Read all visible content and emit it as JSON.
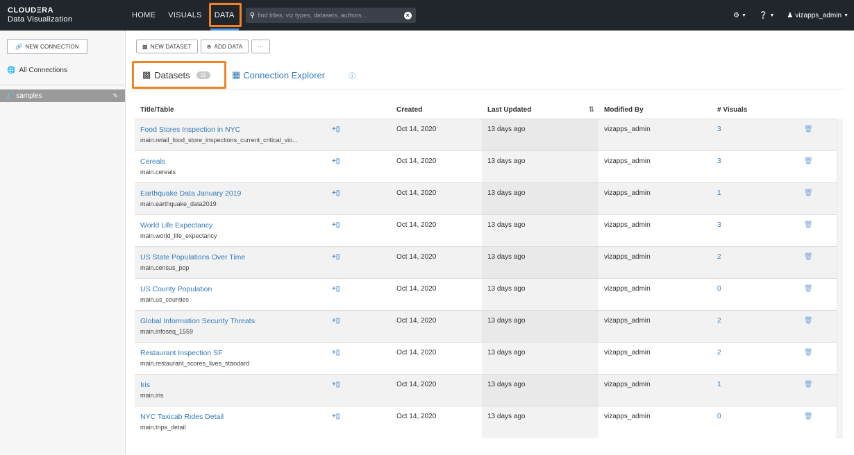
{
  "brand": {
    "line1": "CLOUDΞRA",
    "line2": "Data Visualization"
  },
  "nav": {
    "home": "HOME",
    "visuals": "VISUALS",
    "data": "DATA"
  },
  "search": {
    "placeholder": "find titles, viz types, datasets, authors..."
  },
  "topright": {
    "user": "vizapps_admin"
  },
  "sidebar": {
    "new_connection": "NEW CONNECTION",
    "all_connections": "All Connections",
    "connection": "samples"
  },
  "toolbar": {
    "new_dataset": "NEW DATASET",
    "add_data": "ADD DATA",
    "more": "···"
  },
  "tabs": {
    "datasets": "Datasets",
    "datasets_count": "11",
    "explorer": "Connection Explorer"
  },
  "columns": {
    "title": "Title/Table",
    "created": "Created",
    "last_updated": "Last Updated",
    "modified_by": "Modified By",
    "visuals": "# Visuals"
  },
  "rows": [
    {
      "title": "Food Stores Inspection in NYC",
      "table": "main.retail_food_store_inspections_current_critical_vio...",
      "created": "Oct 14, 2020",
      "updated": "13 days ago",
      "by": "vizapps_admin",
      "visuals": "3"
    },
    {
      "title": "Cereals",
      "table": "main.cereals",
      "created": "Oct 14, 2020",
      "updated": "13 days ago",
      "by": "vizapps_admin",
      "visuals": "3"
    },
    {
      "title": "Earthquake Data January 2019",
      "table": "main.earthquake_data2019",
      "created": "Oct 14, 2020",
      "updated": "13 days ago",
      "by": "vizapps_admin",
      "visuals": "1"
    },
    {
      "title": "World Life Expectancy",
      "table": "main.world_life_expectancy",
      "created": "Oct 14, 2020",
      "updated": "13 days ago",
      "by": "vizapps_admin",
      "visuals": "3"
    },
    {
      "title": "US State Populations Over Time",
      "table": "main.census_pop",
      "created": "Oct 14, 2020",
      "updated": "13 days ago",
      "by": "vizapps_admin",
      "visuals": "2"
    },
    {
      "title": "US County Population",
      "table": "main.us_counties",
      "created": "Oct 14, 2020",
      "updated": "13 days ago",
      "by": "vizapps_admin",
      "visuals": "0"
    },
    {
      "title": "Global Information Security Threats",
      "table": "main.infoseq_1559",
      "created": "Oct 14, 2020",
      "updated": "13 days ago",
      "by": "vizapps_admin",
      "visuals": "2"
    },
    {
      "title": "Restaurant Inspection SF",
      "table": "main.restaurant_scores_lives_standard",
      "created": "Oct 14, 2020",
      "updated": "13 days ago",
      "by": "vizapps_admin",
      "visuals": "2"
    },
    {
      "title": "Iris",
      "table": "main.iris",
      "created": "Oct 14, 2020",
      "updated": "13 days ago",
      "by": "vizapps_admin",
      "visuals": "1"
    },
    {
      "title": "NYC Taxicab Rides Detail",
      "table": "main.trips_detail",
      "created": "Oct 14, 2020",
      "updated": "13 days ago",
      "by": "vizapps_admin",
      "visuals": "0"
    }
  ]
}
